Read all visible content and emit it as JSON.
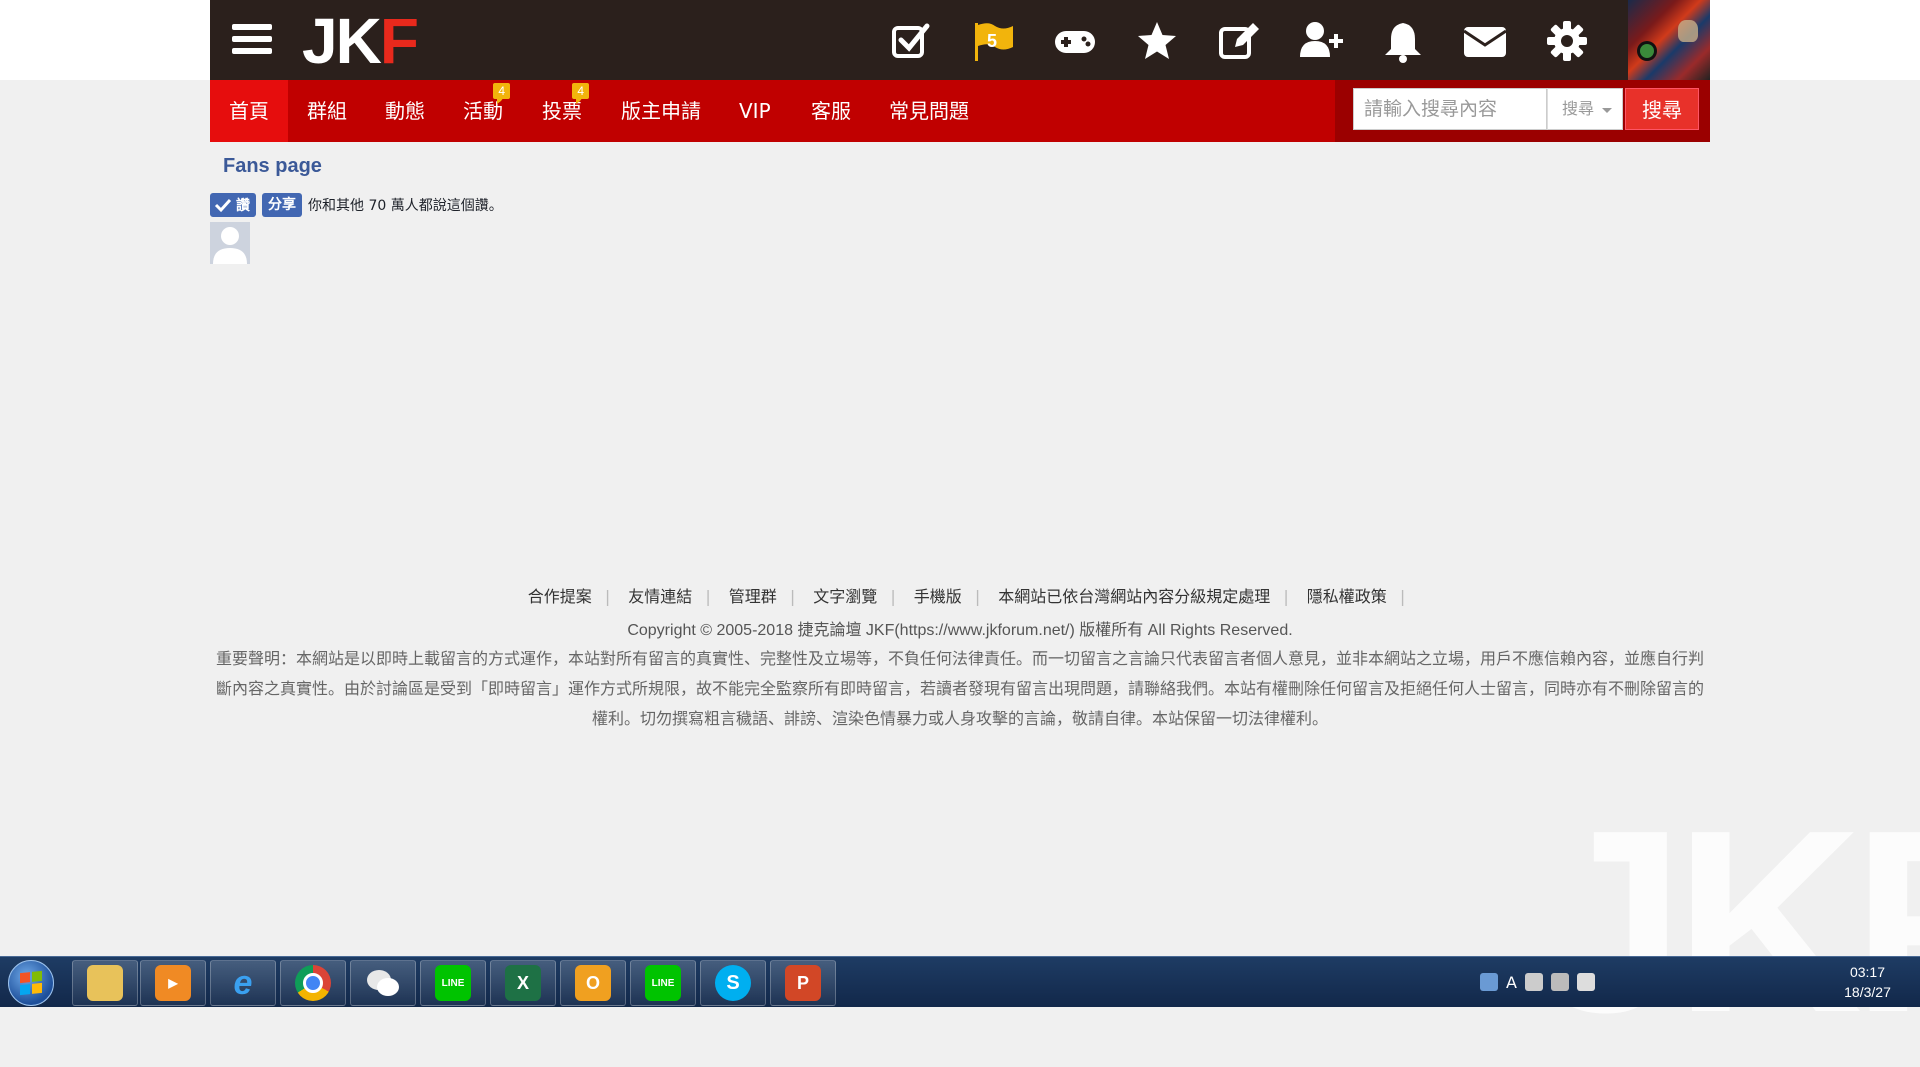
{
  "header": {
    "logo_text_1": "JK",
    "logo_text_2": "F",
    "flag_count": "5",
    "icons": [
      "check-square-icon",
      "flag-icon",
      "gamepad-icon",
      "star-icon",
      "edit-icon",
      "add-user-icon",
      "bell-icon",
      "envelope-icon",
      "gear-icon"
    ]
  },
  "nav": {
    "items": [
      {
        "label": "首頁",
        "active": true
      },
      {
        "label": "群組"
      },
      {
        "label": "動態"
      },
      {
        "label": "活動",
        "badge": "4"
      },
      {
        "label": "投票",
        "badge": "4"
      },
      {
        "label": "版主申請"
      },
      {
        "label": "VIP"
      },
      {
        "label": "客服"
      },
      {
        "label": "常見問題"
      }
    ],
    "search_placeholder": "請輸入搜尋內容",
    "search_select": "搜尋",
    "search_button": "搜尋"
  },
  "fb": {
    "title": "Fans page",
    "like_label": "讚",
    "share_label": "分享",
    "like_text": "你和其他 70 萬人都說這個讚。"
  },
  "footer": {
    "links": [
      "合作提案",
      "友情連結",
      "管理群",
      "文字瀏覽",
      "手機版",
      "本網站已依台灣網站內容分級規定處理",
      "隱私權政策"
    ],
    "copyright": "Copyright © 2005-2018 捷克論壇 JKF(https://www.jkforum.net/) 版權所有 All Rights Reserved.",
    "disclaimer": "重要聲明：本網站是以即時上載留言的方式運作，本站對所有留言的真實性、完整性及立場等，不負任何法律責任。而一切留言之言論只代表留言者個人意見，並非本網站之立場，用戶不應信賴內容，並應自行判斷內容之真實性。由於討論區是受到「即時留言」運作方式所規限，故不能完全監察所有即時留言，若讀者發現有留言出現問題，請聯絡我們。本站有權刪除任何留言及拒絕任何人士留言，同時亦有不刪除留言的權利。切勿撰寫粗言穢語、誹謗、渲染色情暴力或人身攻擊的言論，敬請自律。本站保留一切法律權利。"
  },
  "watermark": "JKF",
  "taskbar": {
    "apps": [
      {
        "name": "file-explorer",
        "label": ""
      },
      {
        "name": "media-player",
        "label": ""
      },
      {
        "name": "internet-explorer",
        "label": "e"
      },
      {
        "name": "chrome",
        "label": ""
      },
      {
        "name": "wechat",
        "label": ""
      },
      {
        "name": "line",
        "label": "LINE"
      },
      {
        "name": "excel",
        "label": "X"
      },
      {
        "name": "outlook",
        "label": "O"
      },
      {
        "name": "line",
        "label": "LINE"
      },
      {
        "name": "skype",
        "label": "S"
      },
      {
        "name": "powerpoint",
        "label": "P"
      }
    ],
    "tray_lang": "A",
    "clock_time": "03:17",
    "clock_date": "18/3/27"
  },
  "colors": {
    "topbar": "#2b201c",
    "navbar": "#c00000",
    "nav_active": "#e60d0d",
    "badge": "#f2b40c",
    "fb_blue": "#4267b2"
  }
}
